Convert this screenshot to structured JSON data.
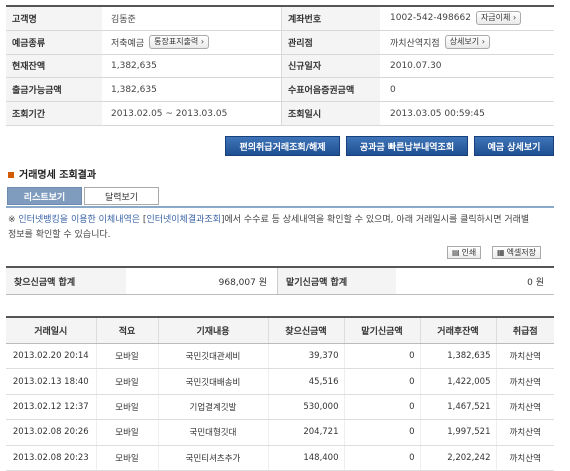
{
  "account": {
    "rows": [
      {
        "l1": "고객명",
        "v1": "김동준",
        "l2": "계좌번호",
        "v2": "1002-542-498662",
        "b2": "자금이체"
      },
      {
        "l1": "예금종류",
        "v1": "저축예금",
        "b1": "통장표지출력",
        "l2": "관리점",
        "v2": "까치산역지점",
        "b2": "상세보기"
      },
      {
        "l1": "현재잔액",
        "v1": "1,382,635",
        "l2": "신규일자",
        "v2": "2010.07.30"
      },
      {
        "l1": "출금가능금액",
        "v1": "1,382,635",
        "l2": "수표어음증권금액",
        "v2": "0"
      },
      {
        "l1": "조회기간",
        "v1": "2013.02.05 ~ 2013.03.05",
        "l2": "조회일시",
        "v2": "2013.03.05 00:59:45"
      }
    ]
  },
  "actions": {
    "b1": "편의취급거래조회/해제",
    "b2": "공과금 빠른납부내역조회",
    "b3": "예금 상세보기"
  },
  "section": {
    "title": "거래명세 조회결과"
  },
  "tabs": {
    "list": "리스트보기",
    "calendar": "달력보기"
  },
  "notice": {
    "prefix": "※ ",
    "link1": "인터넷뱅킹을 이용한 이체내역은",
    "mid": " [",
    "link2": "인터넷이체결과조회",
    "rest": "]에서 수수료 등 상세내역을 확인할 수 있으며, 아래 거래일시를 클릭하시면 거래별 정보를 확인할 수 있습니다."
  },
  "tools": {
    "print": "인쇄",
    "excel": "엑셀저장"
  },
  "summary": {
    "in_label": "찾으신금액 합계",
    "in_value": "968,007 원",
    "out_label": "맡기신금액 합계",
    "out_value": "0 원"
  },
  "table": {
    "headers": [
      "거래일시",
      "적요",
      "기재내용",
      "찾으신금액",
      "맡기신금액",
      "거래후잔액",
      "취급점"
    ],
    "rows": [
      [
        "2013.02.20 20:14",
        "모바일",
        "국민깃대관세비",
        "39,370",
        "0",
        "1,382,635",
        "까치산역"
      ],
      [
        "2013.02.13 18:40",
        "모바일",
        "국민깃대배송비",
        "45,516",
        "0",
        "1,422,005",
        "까치산역"
      ],
      [
        "2013.02.12 12:37",
        "모바일",
        "기업결계깃발",
        "530,000",
        "0",
        "1,467,521",
        "까치산역"
      ],
      [
        "2013.02.08 20:26",
        "모바일",
        "국민대형깃대",
        "204,721",
        "0",
        "1,997,521",
        "까치산역"
      ],
      [
        "2013.02.08 20:23",
        "모바일",
        "국민티셔츠추가",
        "148,400",
        "0",
        "2,202,242",
        "까치산역"
      ]
    ]
  }
}
